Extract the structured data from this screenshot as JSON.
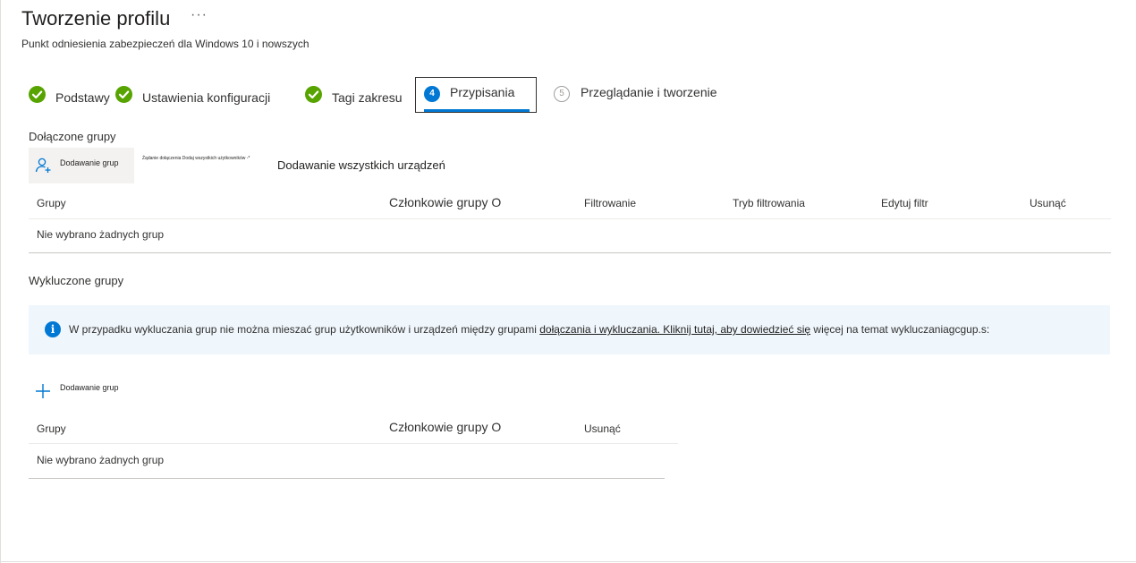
{
  "header": {
    "title": "Tworzenie profilu",
    "more": "···",
    "subtitle": "Punkt odniesienia zabezpieczeń dla Windows 10 i nowszych"
  },
  "steps": [
    {
      "label": "Podstawy",
      "state": "done"
    },
    {
      "label": "Ustawienia konfiguracji",
      "state": "done"
    },
    {
      "label": "Tagi zakresu",
      "state": "done"
    },
    {
      "number": "4",
      "label": "Przypisania",
      "state": "active"
    },
    {
      "number": "5",
      "label": "Przeglądanie i tworzenie",
      "state": "pending"
    }
  ],
  "included": {
    "section_label": "Dołączone grupy",
    "add_groups_label": "Dodawanie grup",
    "add_users_label": "Żądanie dołączenia Dodaj wszystkich użytkowników -*",
    "add_devices_label": "Dodawanie wszystkich urządzeń",
    "columns": [
      "Grupy",
      "Członkowie grupy O",
      "Filtrowanie",
      "Tryb filtrowania",
      "Edytuj filtr",
      "Usunąć"
    ],
    "empty_text": "Nie wybrano żadnych grup"
  },
  "excluded": {
    "section_label": "Wykluczone grupy",
    "info_prefix": "W przypadku wykluczania grup nie można mieszać grup użytkowników i urządzeń między grupami ",
    "info_link": "dołączania i wykluczania. Kliknij tutaj, aby dowiedzieć się",
    "info_suffix": " więcej na temat wykluczaniagcgup.s:",
    "add_groups_label": "Dodawanie grup",
    "columns": [
      "Grupy",
      "Członkowie grupy O",
      "Usunąć"
    ],
    "empty_text": "Nie wybrano żadnych grup"
  },
  "colors": {
    "check_green": "#57a300",
    "accent_blue": "#0078d4",
    "info_bg": "#eff6fc"
  }
}
